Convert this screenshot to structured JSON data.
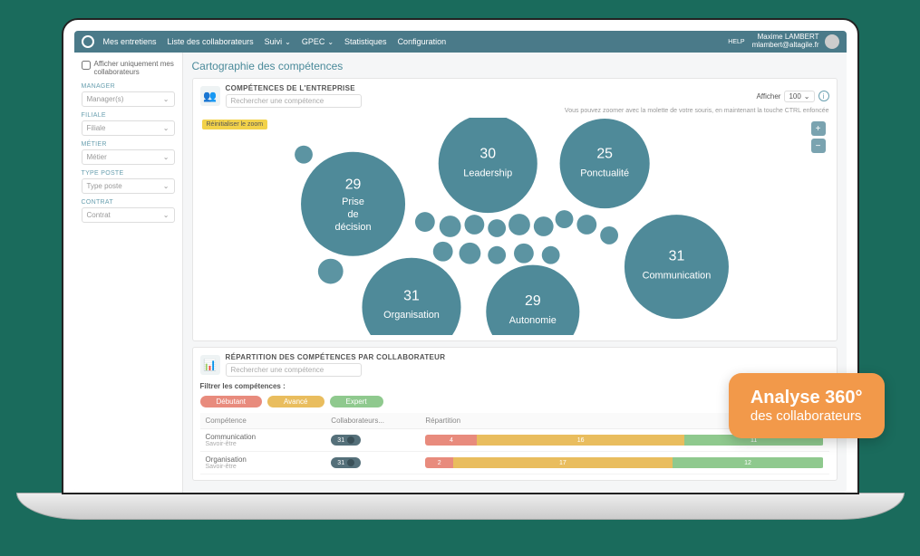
{
  "nav": {
    "items": [
      "Mes entretiens",
      "Liste des collaborateurs",
      "Suivi",
      "GPEC",
      "Statistiques",
      "Configuration"
    ],
    "user_name": "Maxime LAMBERT",
    "user_email": "mlambert@altagile.fr",
    "help_label": "HELP"
  },
  "sidebar": {
    "checkbox_label": "Afficher uniquement mes collaborateurs",
    "filters": [
      {
        "label": "MANAGER",
        "placeholder": "Manager(s)"
      },
      {
        "label": "FILIALE",
        "placeholder": "Filiale"
      },
      {
        "label": "MÉTIER",
        "placeholder": "Métier"
      },
      {
        "label": "TYPE POSTE",
        "placeholder": "Type poste"
      },
      {
        "label": "CONTRAT",
        "placeholder": "Contrat"
      }
    ]
  },
  "page_title": "Cartographie des compétences",
  "card1": {
    "title": "COMPÉTENCES DE L'ENTREPRISE",
    "search_placeholder": "Rechercher une compétence",
    "afficher_label": "Afficher",
    "afficher_value": "100",
    "hint": "Vous pouvez zoomer avec la molette de votre souris, en maintenant la touche CTRL enfoncée",
    "reset_zoom": "Réinitialiser le zoom"
  },
  "chart_data": {
    "type": "bubble",
    "title": "Compétences de l'entreprise",
    "series": [
      {
        "name": "Leadership",
        "value": 30
      },
      {
        "name": "Ponctualité",
        "value": 25
      },
      {
        "name": "Prise de décision",
        "value": 29
      },
      {
        "name": "Communication",
        "value": 31
      },
      {
        "name": "Organisation",
        "value": 31
      },
      {
        "name": "Autonomie",
        "value": 29
      }
    ],
    "small_bubbles_approx_count": 16
  },
  "card2": {
    "title": "RÉPARTITION DES COMPÉTENCES PAR COLLABORATEUR",
    "search_placeholder": "Rechercher une compétence",
    "filter_label": "Filtrer les compétences :",
    "levels": [
      "Débutant",
      "Avancé",
      "Expert"
    ],
    "columns": [
      "Compétence",
      "Collaborateurs...",
      "Répartition"
    ],
    "rows": [
      {
        "name": "Communication",
        "sub": "Savoir-être",
        "count": 31,
        "deb": 4,
        "av": 16,
        "ex": 11
      },
      {
        "name": "Organisation",
        "sub": "Savoir-être",
        "count": 31,
        "deb": 2,
        "av": 17,
        "ex": 12
      }
    ]
  },
  "callout": {
    "line1": "Analyse 360°",
    "line2": "des collaborateurs"
  }
}
